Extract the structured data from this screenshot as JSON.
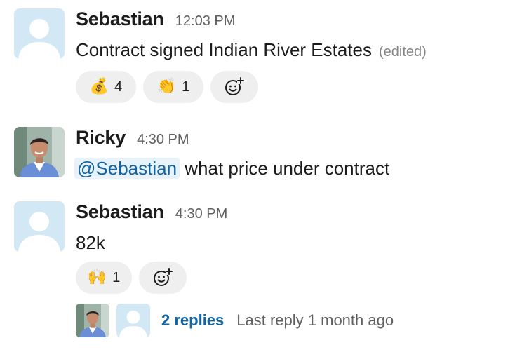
{
  "messages": [
    {
      "author": "Sebastian",
      "time": "12:03 PM",
      "text": "Contract signed Indian River Estates",
      "edited": "(edited)",
      "reactions": [
        {
          "emoji": "💰",
          "count": "4"
        },
        {
          "emoji": "👏",
          "count": "1"
        }
      ]
    },
    {
      "author": "Ricky",
      "time": "4:30 PM",
      "mention": "@Sebastian",
      "text": "what price under contract"
    },
    {
      "author": "Sebastian",
      "time": "4:30 PM",
      "text": "82k",
      "reactions": [
        {
          "emoji": "🙌",
          "count": "1"
        }
      ],
      "thread": {
        "replies": "2 replies",
        "last_reply": "Last reply 1 month ago"
      }
    }
  ],
  "colors": {
    "link": "#1264a3",
    "default_avatar_bg": "#d2e9f5",
    "default_avatar_fg": "#ffffff",
    "reaction_bg": "#efefef"
  },
  "icons": {
    "default_avatar": "person-silhouette-icon",
    "add_reaction": "add-reaction-icon"
  }
}
